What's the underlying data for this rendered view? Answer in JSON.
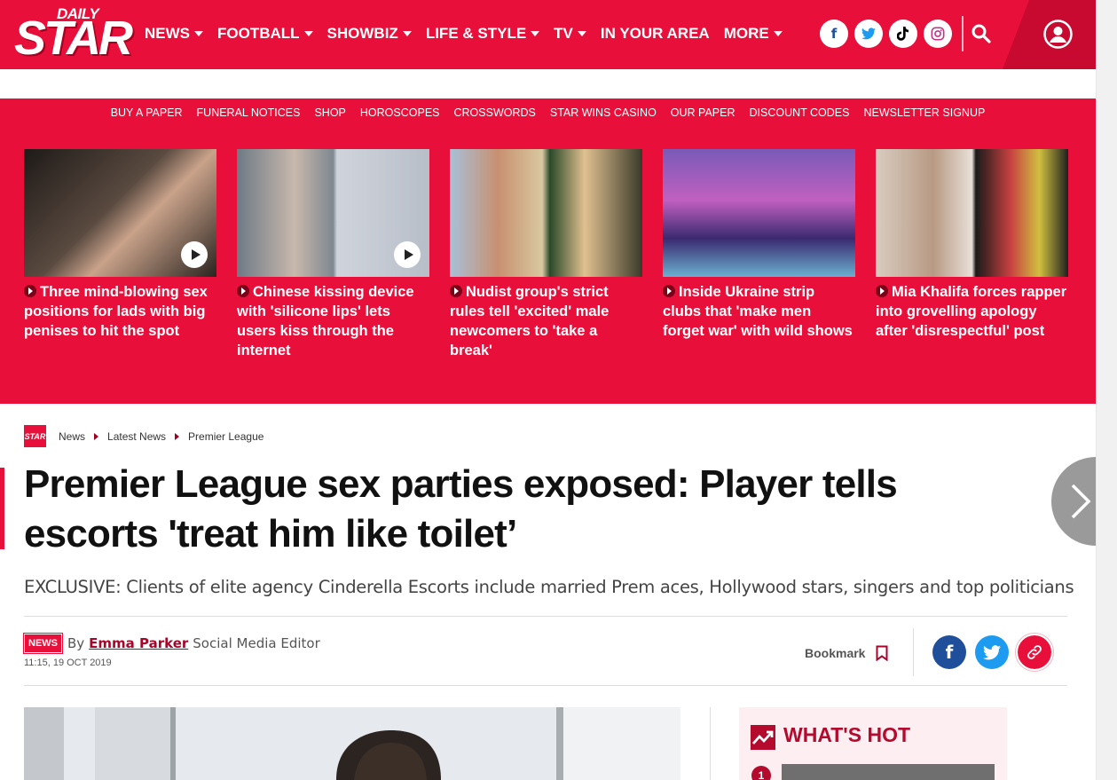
{
  "header": {
    "logo_small": "DAILY",
    "logo_big": "STAR",
    "nav": [
      {
        "label": "NEWS",
        "dropdown": true
      },
      {
        "label": "FOOTBALL",
        "dropdown": true
      },
      {
        "label": "SHOWBIZ",
        "dropdown": true
      },
      {
        "label": "LIFE & STYLE",
        "dropdown": true
      },
      {
        "label": "TV",
        "dropdown": true
      },
      {
        "label": "IN YOUR AREA",
        "dropdown": false
      },
      {
        "label": "MORE",
        "dropdown": true
      }
    ],
    "social_icons": [
      "facebook-icon",
      "twitter-icon",
      "tiktok-icon",
      "instagram-icon"
    ],
    "brand_color": "#e8103a"
  },
  "subnav": [
    "BUY A PAPER",
    "FUNERAL NOTICES",
    "SHOP",
    "HOROSCOPES",
    "CROSSWORDS",
    "STAR WINS CASINO",
    "OUR PAPER",
    "DISCOUNT CODES",
    "NEWSLETTER SIGNUP"
  ],
  "trending": [
    {
      "title": "Three mind-blowing sex positions for lads with big penises to hit the spot",
      "video": true,
      "color": "#3a302c"
    },
    {
      "title": "Chinese kissing device with 'silicone lips' lets users kiss through the internet",
      "video": true,
      "color": "#8a8f95"
    },
    {
      "title": "Nudist group's strict rules tell 'excited' male newcomers to 'take a break'",
      "video": false,
      "color": "#b49070"
    },
    {
      "title": "Inside Ukraine strip clubs that 'make men forget war' with wild shows",
      "video": false,
      "color": "#4b3a8a"
    },
    {
      "title": "Mia Khalifa forces rapper into grovelling apology after 'disrespectful' post",
      "video": false,
      "color": "#c9b8a8"
    }
  ],
  "breadcrumb": {
    "logo": "STAR",
    "items": [
      "News",
      "Latest News",
      "Premier League"
    ]
  },
  "article": {
    "headline": "Premier League sex parties exposed: Player tells escorts 'treat him like toilet’",
    "standfirst": "EXCLUSIVE: Clients of elite agency Cinderella Escorts include married Prem aces, Hollywood stars, singers and top politicians",
    "badge": "NEWS",
    "by": "By",
    "author": "Emma Parker",
    "role": "Social Media Editor",
    "timestamp": "11:15, 19 OCT 2019",
    "bookmark_label": "Bookmark",
    "share_icons": [
      "facebook-icon",
      "twitter-icon",
      "link-icon"
    ]
  },
  "sidebar": {
    "whats_hot_title": "WHAT'S HOT",
    "first_number": "1"
  }
}
